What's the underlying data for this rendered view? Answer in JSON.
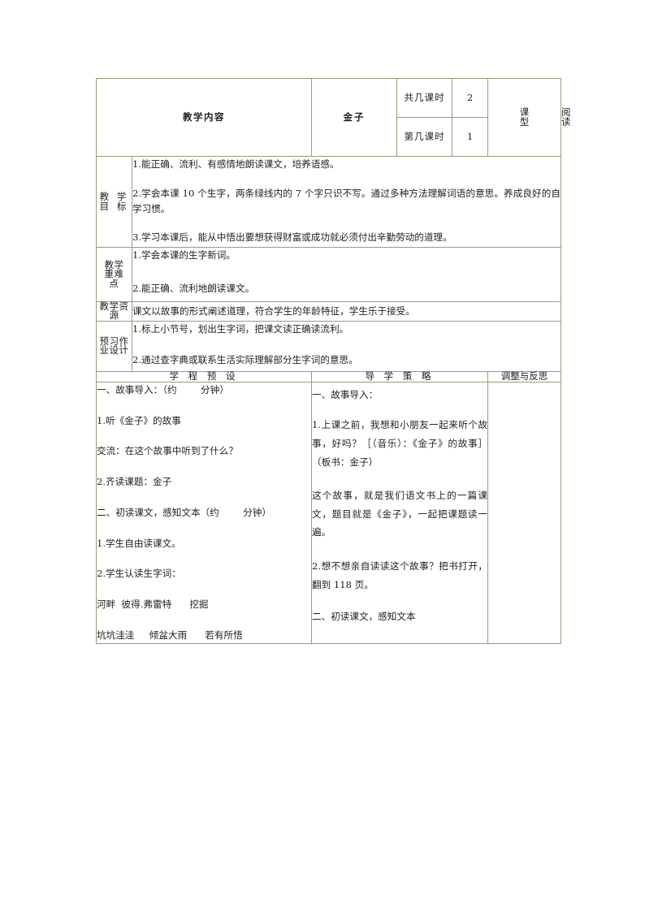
{
  "document": {
    "title": "金子",
    "content_label": "教学内容"
  },
  "header": {
    "total_periods_label": "共几课时",
    "total_periods_value": "2",
    "current_period_label": "第几课时",
    "current_period_value": "1",
    "lesson_type_label": "课型",
    "lesson_type_label_chars": [
      "课",
      "型"
    ],
    "lesson_type_value": "阅读"
  },
  "objectives": {
    "label_chars": [
      "教 学",
      "目 标"
    ],
    "items": [
      "1.能正确、流利、有感情地朗读课文，培养语感。",
      "2.学会本课 10 个生字，两条绿线内的 7 个字只识不写。通过多种方法理解词语的意思。养成良好的自学习惯。",
      "3.学习本课后，能从中悟出要想获得财富或成功就必须付出辛勤劳动的道理。"
    ]
  },
  "key_points": {
    "label_chars": [
      "教学",
      "重难",
      "点"
    ],
    "items": [
      "1.学会本课的生字新词。",
      "2.能正确、流利地朗读课文。"
    ]
  },
  "resources": {
    "label_chars": [
      "教学资",
      "源"
    ],
    "text": "课文以故事的形式阐述道理，符合学生的年龄特征，学生乐于接受。"
  },
  "preview": {
    "label_chars": [
      "预习作",
      "业设计"
    ],
    "items": [
      "1.标上小节号，划出生字词，把课文读正确读流利。",
      "2.通过查字典或联系生活实际理解部分生字词的意思。"
    ]
  },
  "process": {
    "headers": {
      "left": "学 程 预 设",
      "middle": "导 学 策 略",
      "right": "调整与反思"
    },
    "left_column": [
      "一、故事导入：（约        分钟）",
      "1.听《金子》的故事",
      "交流：在这个故事中听到了什么？",
      "2.齐读课题：金子",
      "二、初读课文，感知文本（约        分钟）",
      "1.学生自由读课文。",
      "2.学生认读生字词：",
      "河畔  彼得.弗雷特      挖掘",
      "坑坑洼洼     倾盆大雨      若有所悟"
    ],
    "middle_column": [
      "一、故事导入：",
      "1.上课之前，我想和小朋友一起来听个故事，好吗？［（音乐）：《金子》的故事］（板书：金子）",
      "这个故事，就是我们语文书上的一篇课文，题目就是《金子》，一起把课题读一遍。",
      "2.想不想亲自读读这个故事？把书打开，翻到 118 页。",
      "二、初读课文，感知文本"
    ],
    "right_column": []
  },
  "colors": {
    "border": "#9a9a7e",
    "text": "#1f1f1f",
    "background": "#ffffff"
  }
}
